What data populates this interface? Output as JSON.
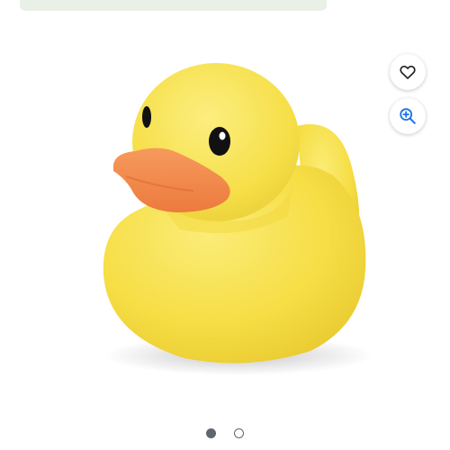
{
  "page": {
    "background": "#ffffff"
  },
  "banner": {
    "color": "#e9f1e7"
  },
  "product": {
    "image": "yellow-rubber-duck",
    "colors": {
      "body": "#f9e45a",
      "beak": "#f58a4e",
      "eye": "#111111"
    }
  },
  "actions": {
    "wishlist": {
      "icon": "heart-outline-icon",
      "color": "#202124"
    },
    "zoom": {
      "icon": "zoom-in-icon",
      "color": "#1a73e8"
    }
  },
  "carousel": {
    "total": 2,
    "current": 1,
    "dot_color": "#5f6670"
  }
}
